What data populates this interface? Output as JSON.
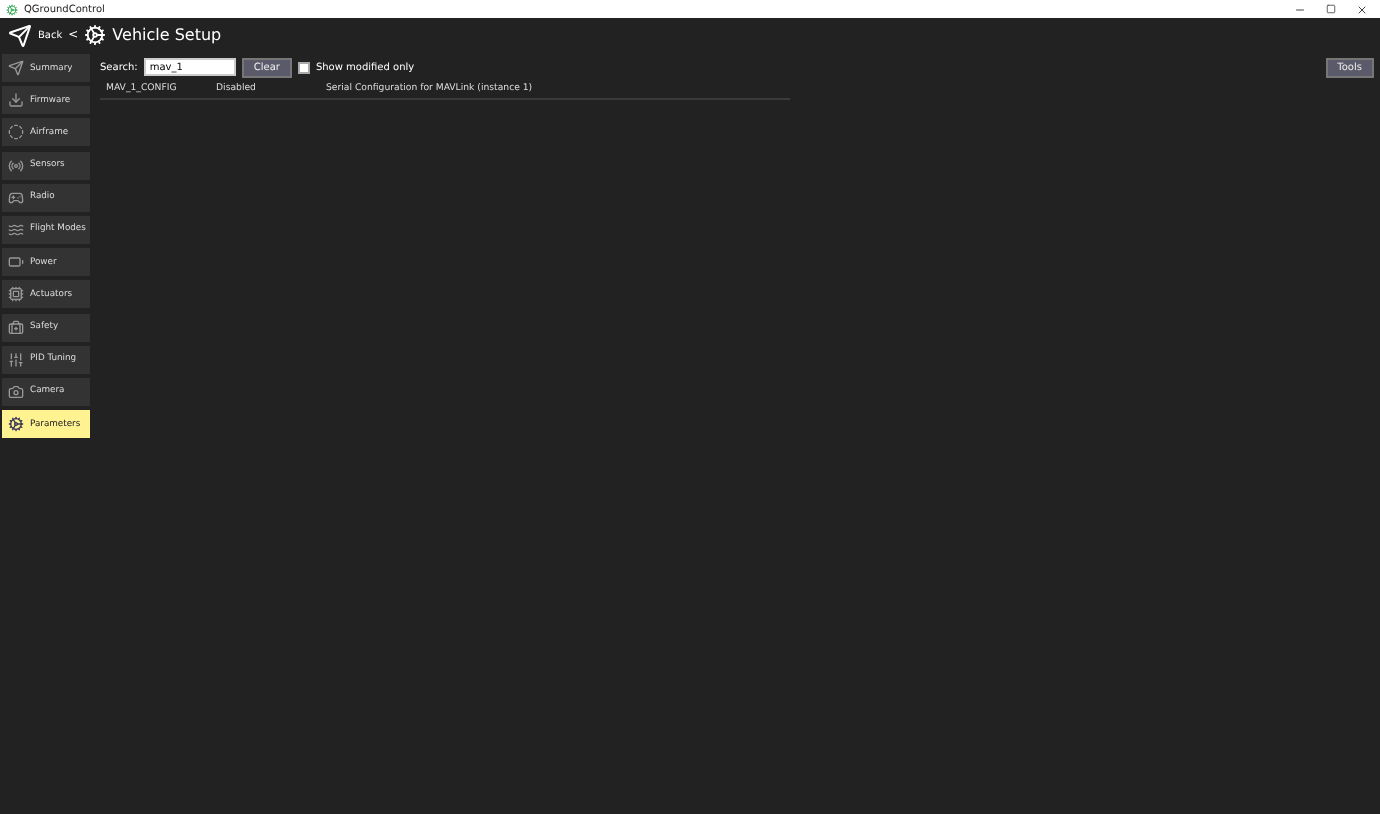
{
  "window": {
    "title": "QGroundControl"
  },
  "toolbar": {
    "back": "Back",
    "separator": "<",
    "title": "Vehicle Setup"
  },
  "sidebar": {
    "items": [
      {
        "label": "Summary",
        "kind": "summary",
        "selected": false
      },
      {
        "label": "Firmware",
        "kind": "firmware",
        "selected": false
      },
      {
        "label": "Airframe",
        "kind": "airframe",
        "selected": false
      },
      {
        "label": "Sensors",
        "kind": "sensors",
        "selected": false
      },
      {
        "label": "Radio",
        "kind": "radio",
        "selected": false
      },
      {
        "label": "Flight Modes",
        "kind": "modes",
        "selected": false
      },
      {
        "label": "Power",
        "kind": "power",
        "selected": false
      },
      {
        "label": "Actuators",
        "kind": "actuators",
        "selected": false
      },
      {
        "label": "Safety",
        "kind": "safety",
        "selected": false
      },
      {
        "label": "PID Tuning",
        "kind": "pid",
        "selected": false
      },
      {
        "label": "Camera",
        "kind": "camera",
        "selected": false
      },
      {
        "label": "Parameters",
        "kind": "parameters",
        "selected": true
      }
    ]
  },
  "search": {
    "label": "Search:",
    "value": "mav_1",
    "clear": "Clear",
    "show_modified": {
      "label": "Show modified only",
      "checked": false
    }
  },
  "tools": "Tools",
  "table": {
    "rows": [
      {
        "name": "MAV_1_CONFIG",
        "value": "Disabled",
        "description": "Serial Configuration for MAVLink (instance 1)"
      }
    ]
  }
}
